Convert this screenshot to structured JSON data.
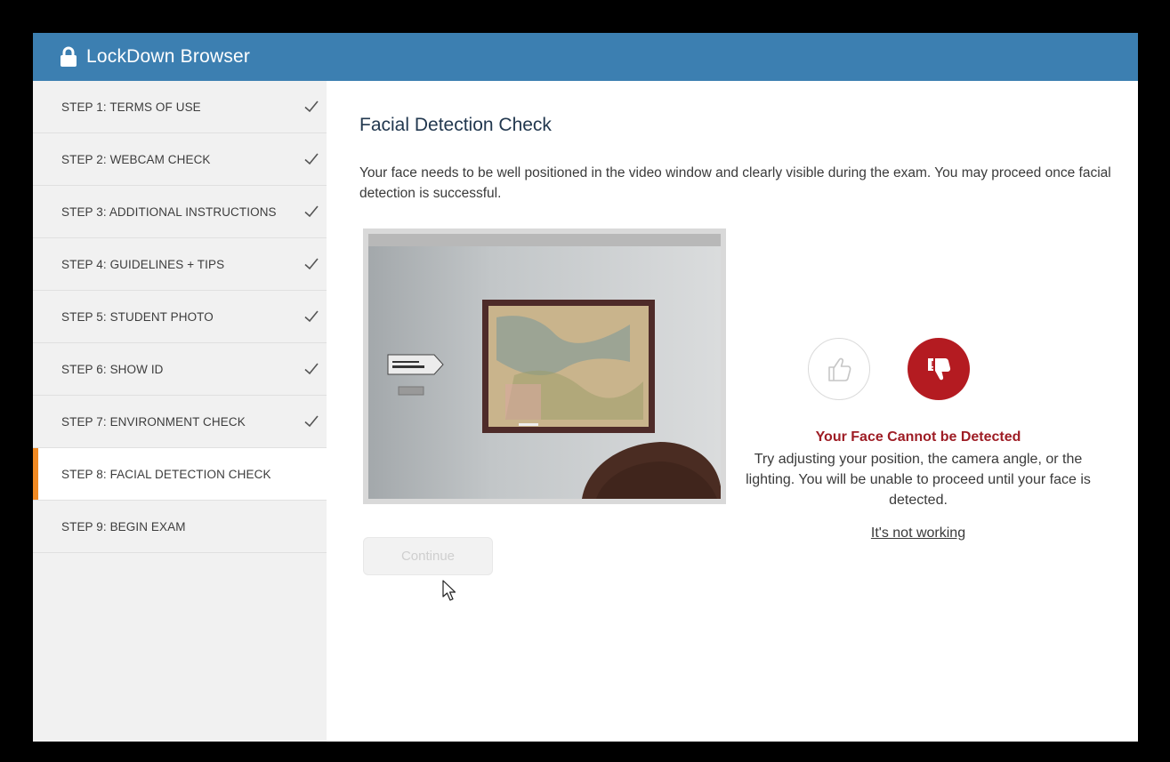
{
  "window": {
    "title": "LockDown Browser"
  },
  "sidebar": {
    "items": [
      {
        "label": "STEP 1: TERMS OF USE",
        "complete": true,
        "active": false
      },
      {
        "label": "STEP 2: WEBCAM CHECK",
        "complete": true,
        "active": false
      },
      {
        "label": "STEP 3: ADDITIONAL INSTRUCTIONS",
        "complete": true,
        "active": false
      },
      {
        "label": "STEP 4: GUIDELINES + TIPS",
        "complete": true,
        "active": false
      },
      {
        "label": "STEP 5: STUDENT PHOTO",
        "complete": true,
        "active": false
      },
      {
        "label": "STEP 6: SHOW ID",
        "complete": true,
        "active": false
      },
      {
        "label": "STEP 7: ENVIRONMENT CHECK",
        "complete": true,
        "active": false
      },
      {
        "label": "STEP 8: FACIAL DETECTION CHECK",
        "complete": false,
        "active": true
      },
      {
        "label": "STEP 9: BEGIN EXAM",
        "complete": false,
        "active": false
      }
    ]
  },
  "main": {
    "heading": "Facial Detection Check",
    "description": "Your face needs to be well positioned in the video window and clearly visible during the exam. You may proceed once facial detection is successful.",
    "status": {
      "title": "Your Face Cannot be Detected",
      "message": "Try adjusting your position, the camera angle, or the lighting. You will be unable to proceed until your face is detected."
    },
    "help_link": "It's not working",
    "continue_label": "Continue"
  },
  "colors": {
    "titlebar": "#3c7fb1",
    "active_step_accent": "#f08a24",
    "error_red": "#b41b21",
    "sidebar_bg": "#f1f1f1"
  },
  "icons": {
    "title": "lock-icon",
    "step_complete": "checkmark-icon",
    "face_ok": "thumbs-up-icon",
    "face_fail": "thumbs-down-icon",
    "pointer": "mouse-cursor-icon"
  }
}
